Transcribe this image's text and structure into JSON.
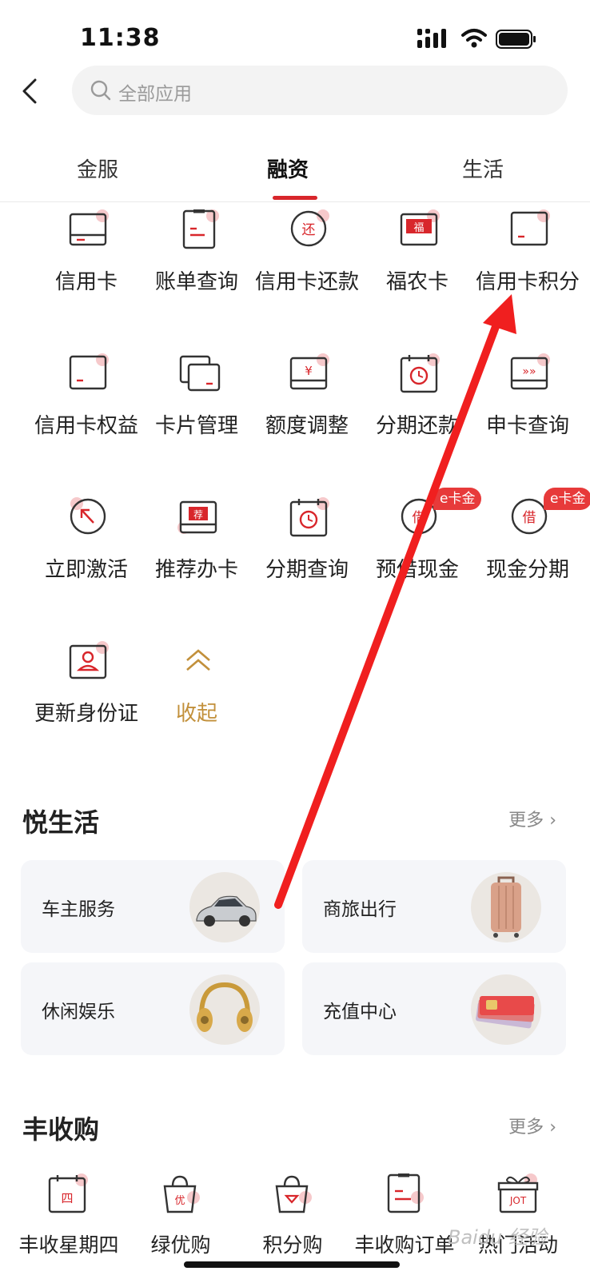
{
  "status": {
    "time": "11:38"
  },
  "search": {
    "placeholder": "全部应用"
  },
  "tabs": [
    {
      "label": "金服"
    },
    {
      "label": "融资"
    },
    {
      "label": "生活"
    }
  ],
  "active_tab": "融资",
  "apps": [
    {
      "label": "信用卡",
      "icon": "credit-card-icon"
    },
    {
      "label": "账单查询",
      "icon": "bill-icon"
    },
    {
      "label": "信用卡还款",
      "icon": "repay-icon",
      "glyph": "还"
    },
    {
      "label": "福农卡",
      "icon": "card-icon",
      "glyph": "福"
    },
    {
      "label": "信用卡积分",
      "icon": "points-card-icon"
    },
    {
      "label": "信用卡权益",
      "icon": "card-benefit-icon"
    },
    {
      "label": "卡片管理",
      "icon": "cards-icon"
    },
    {
      "label": "额度调整",
      "icon": "limit-icon",
      "glyph": "¥"
    },
    {
      "label": "分期还款",
      "icon": "calendar-clock-icon"
    },
    {
      "label": "申卡查询",
      "icon": "apply-query-icon",
      "glyph": "»»"
    },
    {
      "label": "立即激活",
      "icon": "activate-icon"
    },
    {
      "label": "推荐办卡",
      "icon": "recommend-card-icon",
      "glyph": "荐"
    },
    {
      "label": "分期查询",
      "icon": "calendar-clock-icon"
    },
    {
      "label": "预借现金",
      "icon": "borrow-icon",
      "glyph": "借",
      "badge": "e卡金"
    },
    {
      "label": "现金分期",
      "icon": "borrow-icon",
      "glyph": "借",
      "badge": "e卡金"
    },
    {
      "label": "更新身份证",
      "icon": "id-card-icon"
    },
    {
      "label": "收起",
      "icon": "chevron-up-icon"
    }
  ],
  "yue": {
    "title": "悦生活",
    "more": "更多",
    "cards": [
      {
        "label": "车主服务",
        "icon": "car-icon"
      },
      {
        "label": "商旅出行",
        "icon": "luggage-icon"
      },
      {
        "label": "休闲娱乐",
        "icon": "headphones-icon"
      },
      {
        "label": "充值中心",
        "icon": "sim-card-icon"
      }
    ]
  },
  "feng": {
    "title": "丰收购",
    "more": "更多",
    "items": [
      {
        "label": "丰收星期四",
        "icon": "calendar-icon",
        "glyph": "四"
      },
      {
        "label": "绿优购",
        "icon": "shopping-bag-icon",
        "glyph": "优"
      },
      {
        "label": "积分购",
        "icon": "shopping-bag-icon"
      },
      {
        "label": "丰收购订单",
        "icon": "order-icon"
      },
      {
        "label": "热门活动",
        "icon": "gift-icon",
        "glyph": "JOT"
      }
    ]
  },
  "watermark": "Baidu 经验",
  "colors": {
    "accent": "#d8262b",
    "collapse": "#c2903b",
    "badge": "#e73a3a",
    "arrow": "#f01f1f"
  }
}
